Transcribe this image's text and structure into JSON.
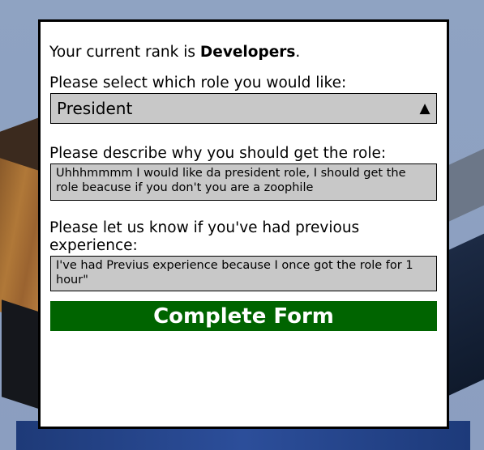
{
  "form": {
    "rank_prefix": "Your current rank is ",
    "rank_value": "Developers",
    "rank_suffix": ".",
    "role_prompt": "Please select which role you would like:",
    "role_selected": "President",
    "dropdown_arrow_icon": "triangle-up-icon",
    "reason_prompt": "Please describe why you should get the role:",
    "reason_text": "Uhhhmmmm I would like da president role, I should get the role beacuse if you don't you are a zoophile",
    "experience_prompt": "Please let us know if you've had previous experience:",
    "experience_text": "I've had Previus experience because I once got the role for 1 hour\"",
    "submit_label": "Complete Form",
    "colors": {
      "panel": "#ffffff",
      "field": "#c8c8c8",
      "submit": "#006400",
      "submit_text": "#ffffff"
    }
  }
}
